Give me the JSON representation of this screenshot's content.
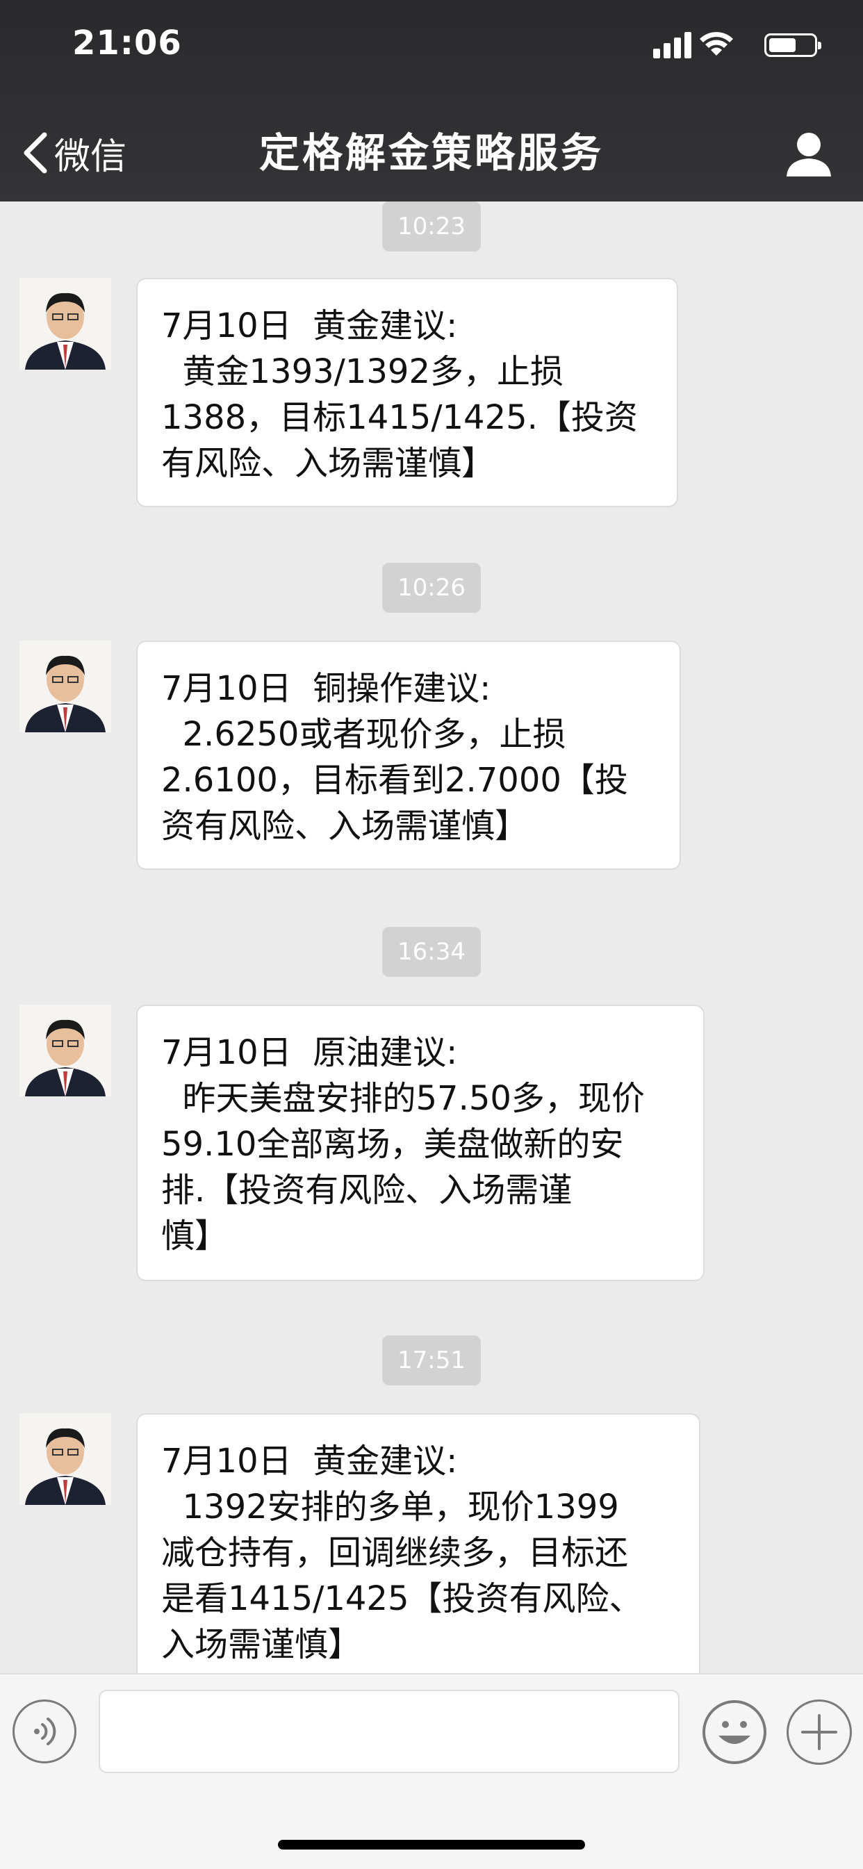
{
  "status_bar": {
    "time": "21:06"
  },
  "nav": {
    "back_label": "微信",
    "title": "定格解金策略服务"
  },
  "messages": [
    {
      "time": "10:23",
      "lines": [
        "7月10日  黄金建议:",
        "  黄金1393/1392多，止损",
        "1388，目标1415/1425.【投资",
        "有风险、入场需谨慎】"
      ]
    },
    {
      "time": "10:26",
      "lines": [
        "7月10日  铜操作建议:",
        "  2.6250或者现价多，止损",
        "2.6100，目标看到2.7000【投",
        "资有风险、入场需谨慎】"
      ]
    },
    {
      "time": "16:34",
      "lines": [
        "7月10日  原油建议:",
        "  昨天美盘安排的57.50多，现价",
        "59.10全部离场，美盘做新的安",
        "排.【投资有风险、入场需谨",
        "慎】"
      ]
    },
    {
      "time": "17:51",
      "lines": [
        "7月10日  黄金建议:",
        "  1392安排的多单，现价1399",
        "减仓持有，回调继续多，目标还",
        "是看1415/1425【投资有风险、",
        "入场需谨慎】"
      ]
    }
  ],
  "input": {
    "value": ""
  },
  "colors": {
    "header": "#2f2f31",
    "chat_bg": "#ebebeb",
    "bubble": "#ffffff",
    "timestamp_bg": "#d2d2d2"
  }
}
